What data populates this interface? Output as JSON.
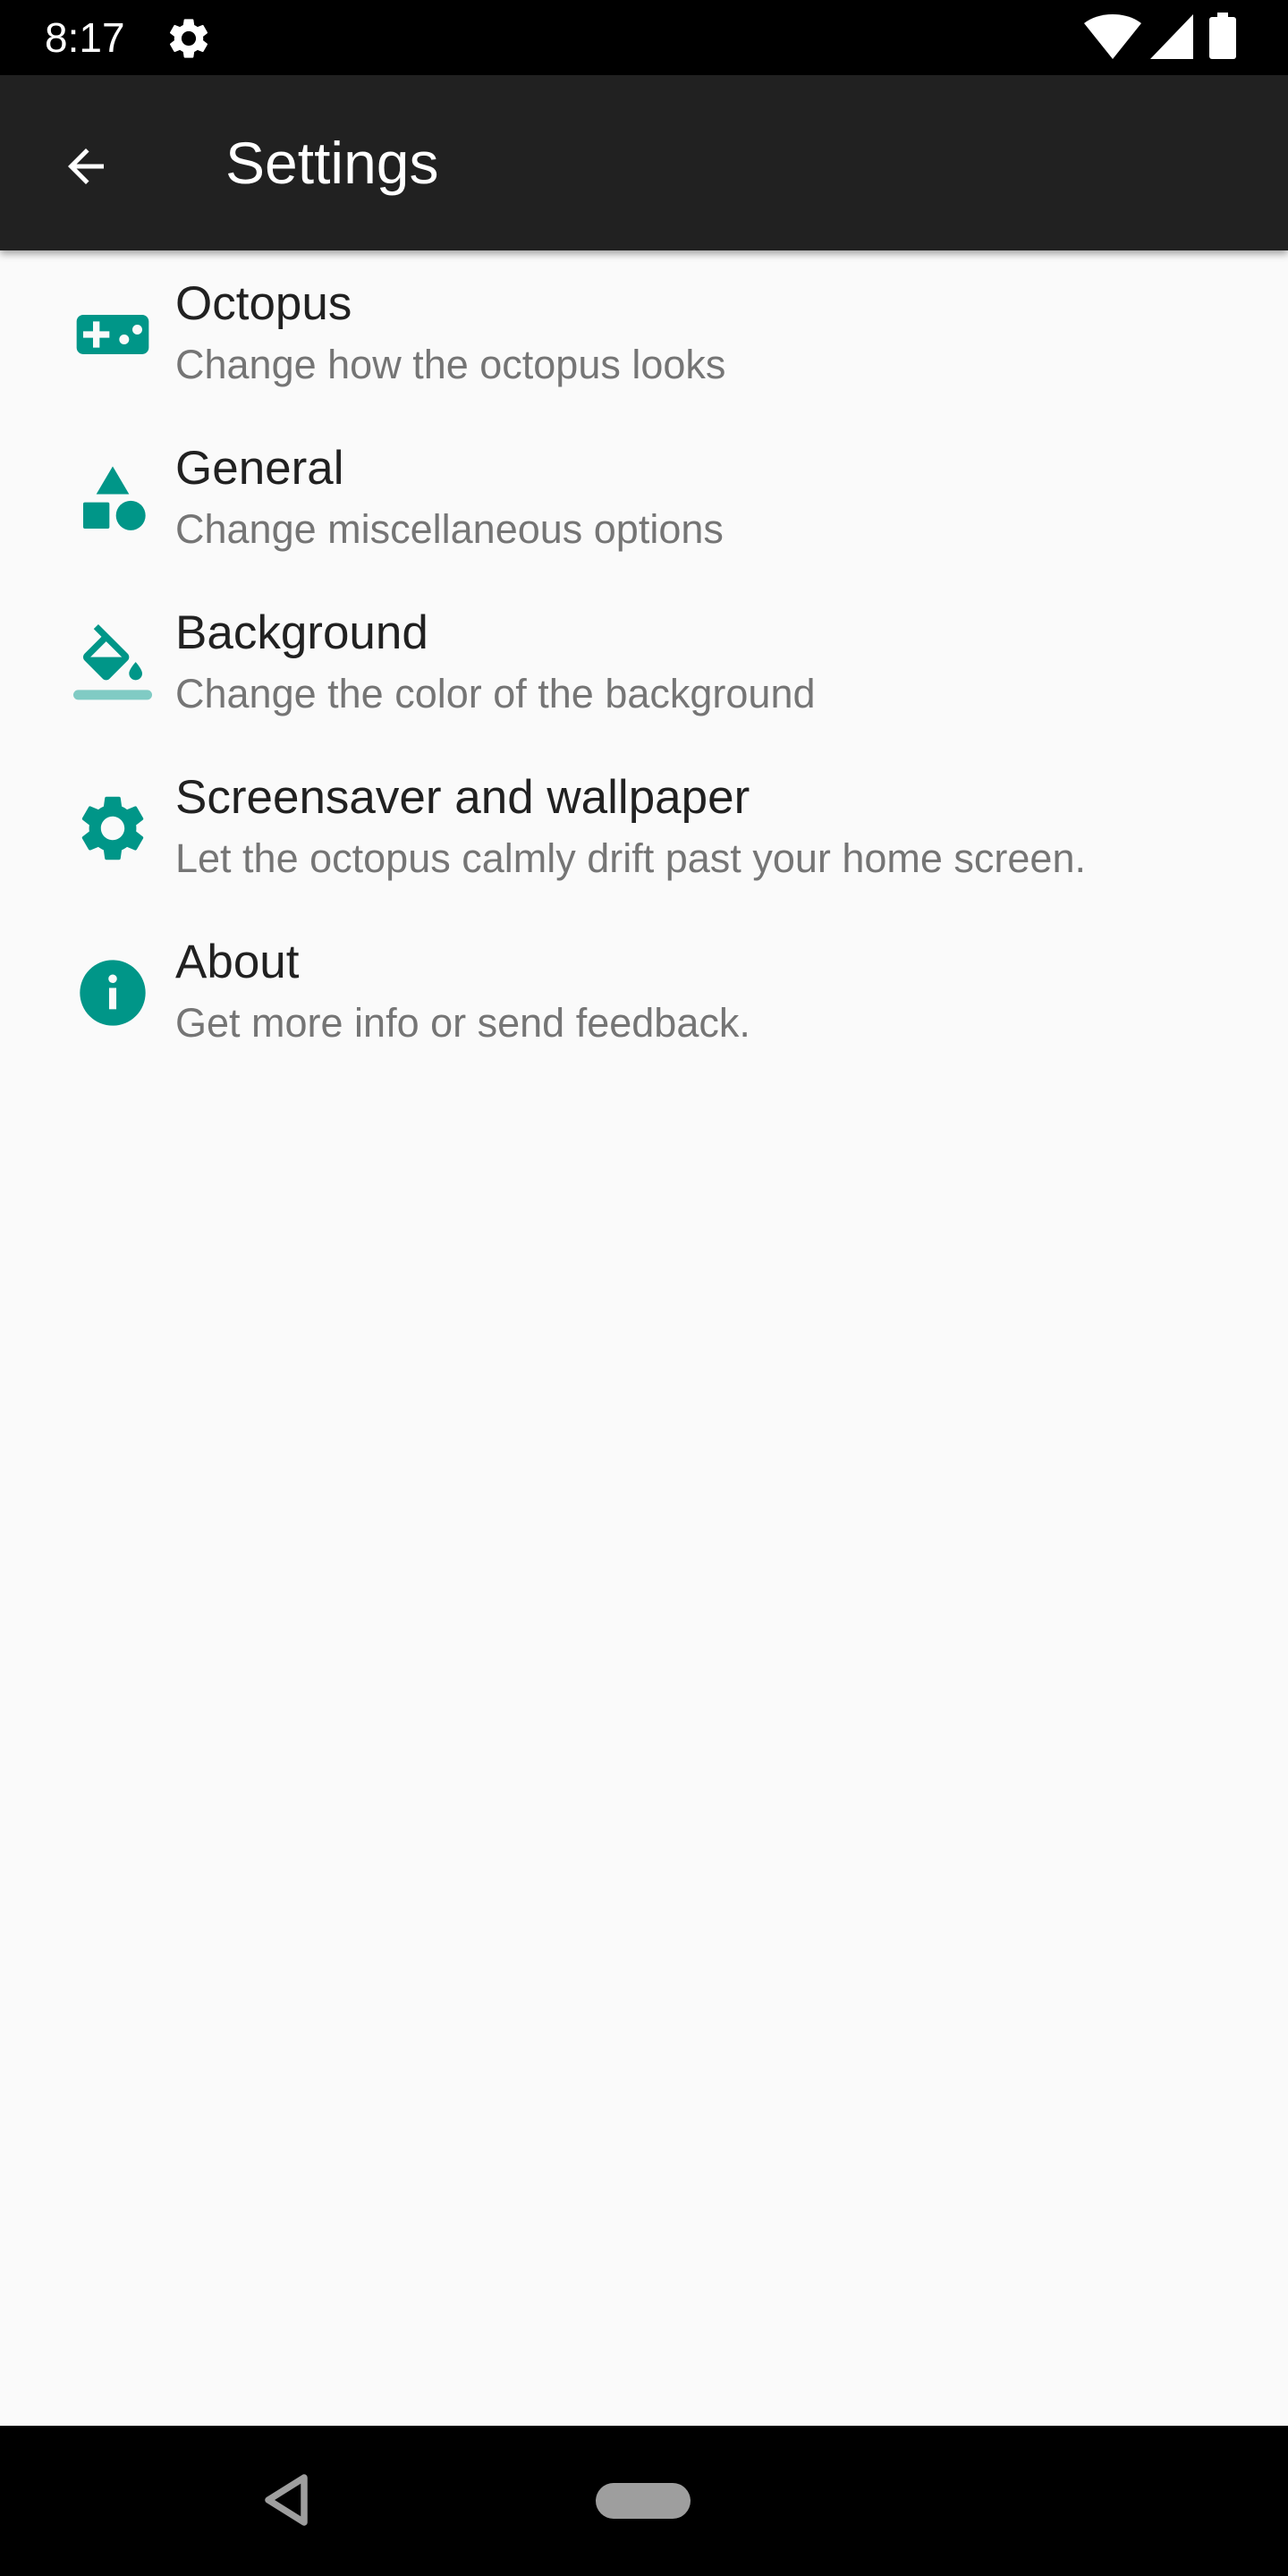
{
  "status_bar": {
    "time": "8:17",
    "icons": [
      "gear-icon",
      "wifi-icon",
      "signal-icon",
      "battery-icon"
    ]
  },
  "app_bar": {
    "title": "Settings",
    "back_icon": "arrow-back-icon"
  },
  "settings": {
    "items": [
      {
        "title": "Octopus",
        "summary": "Change how the octopus looks",
        "icon": "gamepad-icon"
      },
      {
        "title": "General",
        "summary": "Change miscellaneous options",
        "icon": "shapes-icon"
      },
      {
        "title": "Background",
        "summary": "Change the color of the background",
        "icon": "paint-bucket-icon"
      },
      {
        "title": "Screensaver and wallpaper",
        "summary": "Let the octopus calmly drift past your home screen.",
        "icon": "gear-icon"
      },
      {
        "title": "About",
        "summary": "Get more info or send feedback.",
        "icon": "info-icon"
      }
    ]
  },
  "nav_bar": {
    "icons": [
      "nav-back-icon",
      "nav-home-pill"
    ]
  },
  "colors": {
    "accent": "#009688",
    "accent_light": "#80cbc4",
    "app_bar": "#212121",
    "background": "#fafafa",
    "title_text": "#212121",
    "summary_text": "#757575"
  }
}
